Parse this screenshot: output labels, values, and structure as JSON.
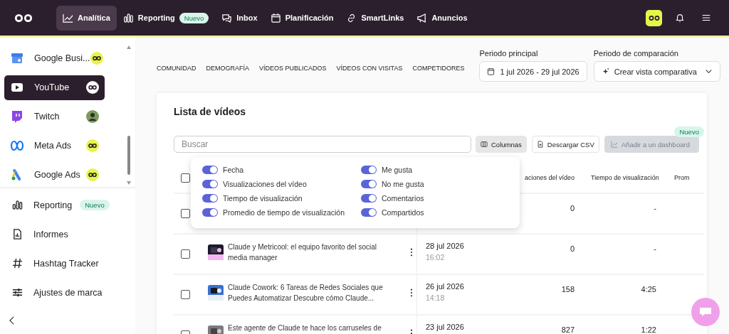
{
  "top_nav": {
    "items": [
      {
        "label": "Analítica",
        "selected": true
      },
      {
        "label": "Reporting",
        "badge": "Nuevo",
        "selected": false
      },
      {
        "label": "Inbox",
        "selected": false
      },
      {
        "label": "Planificación",
        "selected": false
      },
      {
        "label": "SmartLinks",
        "selected": false
      },
      {
        "label": "Anuncios",
        "selected": false
      }
    ]
  },
  "sidebar": {
    "accounts": [
      {
        "label": "Google Busi...",
        "kind": "brand",
        "selected": false
      },
      {
        "label": "YouTube",
        "kind": "brand",
        "selected": true
      },
      {
        "label": "Twitch",
        "selected": false
      },
      {
        "label": "Meta Ads",
        "kind": "brand",
        "selected": false
      },
      {
        "label": "Google Ads",
        "kind": "brand",
        "selected": false
      }
    ],
    "items": [
      {
        "label": "Reporting",
        "badge": "Nuevo"
      },
      {
        "label": "Informes"
      },
      {
        "label": "Hashtag Tracker"
      },
      {
        "label": "Ajustes de marca"
      }
    ]
  },
  "tabs": [
    {
      "label": "COMUNIDAD",
      "selected": false
    },
    {
      "label": "DEMOGRAFÍA",
      "selected": false
    },
    {
      "label": "VÍDEOS PUBLICADOS",
      "selected": false
    },
    {
      "label": "VÍDEOS CON VISITAS",
      "selected": false
    },
    {
      "label": "COMPETIDORES",
      "selected": false
    }
  ],
  "periods": [
    {
      "label": "Periodo principal",
      "value": "1 jul 2026 - 29 jul 2026",
      "kind": "date"
    },
    {
      "label": "Periodo de comparación",
      "value": "Crear vista comparativa",
      "kind": "compare"
    }
  ],
  "card": {
    "title": "Lista de vídeos",
    "search": {
      "placeholder": "Buscar"
    },
    "buttons": [
      {
        "label": "Columnas",
        "pressed": true,
        "disabled": false
      },
      {
        "label": "Descargar CSV",
        "pressed": false,
        "disabled": false
      },
      {
        "label": "Añadir a un dashboard",
        "pressed": false,
        "disabled": true,
        "badge": "Nuevo"
      }
    ],
    "columns_menu": {
      "options": [
        {
          "label": "Fecha",
          "on": true
        },
        {
          "label": "Visualizaciones del vídeo",
          "on": true
        },
        {
          "label": "Tiempo de visualización",
          "on": true
        },
        {
          "label": "Promedio de tiempo de visualización",
          "on": true
        },
        {
          "label": "Me gusta",
          "on": true
        },
        {
          "label": "No me gusta",
          "on": true
        },
        {
          "label": "Comentarios",
          "on": true
        },
        {
          "label": "Compartidos",
          "on": true
        }
      ]
    },
    "table": {
      "header_checked": false,
      "columns": [
        {
          "label": "aciones del vídeo"
        },
        {
          "label": "Tiempo de visualización"
        },
        {
          "label": "Prom"
        }
      ],
      "rows": [
        {
          "checked": false,
          "views": "0",
          "watch_time": "-"
        },
        {
          "checked": false,
          "title": "Claude y Metricool: el equipo favorito del social media manager",
          "date": "28 jul 2026",
          "time": "16:02",
          "views": "0",
          "watch_time": "-"
        },
        {
          "checked": false,
          "title": "Claude Cowork: 6 Tareas de Redes Sociales que Puedes Automatizar Descubre cómo Claude...",
          "date": "26 jul 2026",
          "time": "14:18",
          "views": "158",
          "watch_time": "4:25"
        },
        {
          "checked": false,
          "title": "Este agente de Claude te hace los carruseles de",
          "date": "23 jul 2026",
          "views": "827",
          "watch_time": "1:22"
        }
      ]
    }
  }
}
